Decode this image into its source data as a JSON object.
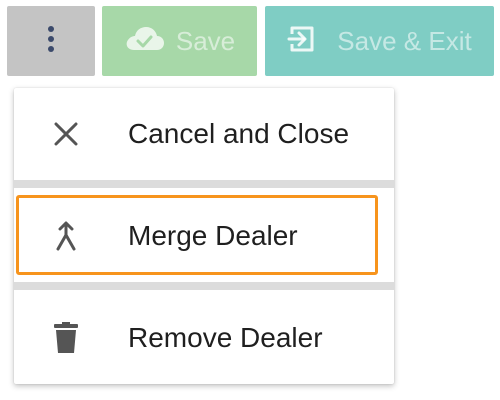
{
  "toolbar": {
    "more_icon": "more-vertical-icon",
    "save_label": "Save",
    "save_icon": "cloud-check-icon",
    "save_exit_label": "Save & Exit",
    "save_exit_icon": "exit-arrow-icon",
    "colors": {
      "more_bg": "#c4c4c4",
      "save_bg": "#a7d8a8",
      "save_exit_bg": "#7fcdc4"
    }
  },
  "menu": {
    "items": [
      {
        "label": "Cancel and Close",
        "icon": "close-icon"
      },
      {
        "label": "Merge Dealer",
        "icon": "merge-icon",
        "highlighted": true
      },
      {
        "label": "Remove Dealer",
        "icon": "trash-icon"
      }
    ],
    "highlight_color": "#f7941d"
  }
}
